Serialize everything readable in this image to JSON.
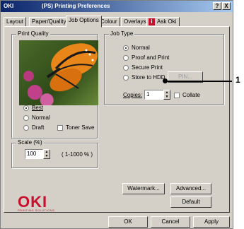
{
  "window": {
    "logo": "OKI",
    "title": "(PS) Printing Preferences",
    "help_btn": "?",
    "close_btn": "X"
  },
  "tabs": [
    "Layout",
    "Paper/Quality",
    "Job Options",
    "Colour",
    "Overlays",
    "Ask Oki"
  ],
  "print_quality": {
    "label": "Print Quality",
    "options": [
      "Best",
      "Normal",
      "Draft"
    ],
    "selected": "Best",
    "toner_save": "Toner Save"
  },
  "job_type": {
    "label": "Job Type",
    "options": [
      "Normal",
      "Proof and Print",
      "Secure Print",
      "Store to HDD"
    ],
    "selected": "Normal",
    "pin_button": "PIN...",
    "copies_label": "Copies:",
    "copies_value": "1",
    "collate": "Collate"
  },
  "scale": {
    "label": "Scale (%)",
    "value": "100",
    "range": "( 1-1000 % )"
  },
  "buttons": {
    "watermark": "Watermark...",
    "advanced": "Advanced...",
    "default": "Default",
    "ok": "OK",
    "cancel": "Cancel",
    "apply": "Apply"
  },
  "brand": {
    "name": "OKI",
    "tagline": "PRINTING SOLUTIONS"
  },
  "callout": "1"
}
